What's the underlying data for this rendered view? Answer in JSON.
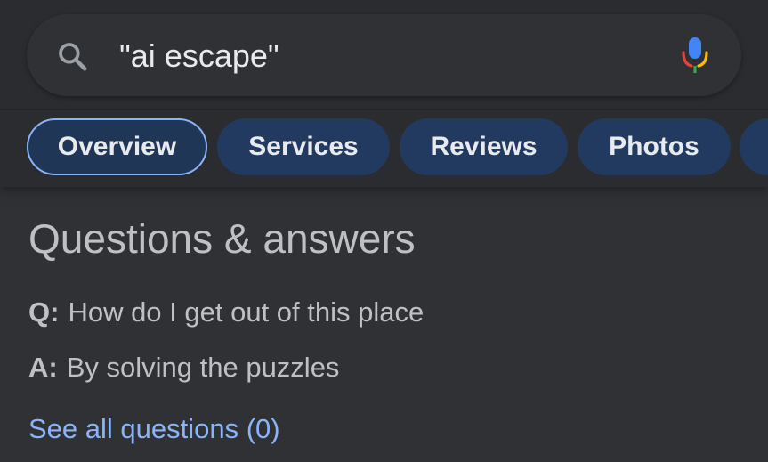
{
  "search": {
    "query": "\"ai escape\"",
    "search_icon": "search-icon",
    "mic_icon": "microphone-icon"
  },
  "tabs": [
    {
      "label": "Overview",
      "active": true
    },
    {
      "label": "Services",
      "active": false
    },
    {
      "label": "Reviews",
      "active": false
    },
    {
      "label": "Photos",
      "active": false
    }
  ],
  "qa": {
    "heading": "Questions & answers",
    "question_prefix": "Q:",
    "question_text": "How do I get out of this place",
    "answer_prefix": "A:",
    "answer_text": "By solving the puzzles",
    "see_all_label": "See all questions (0)"
  },
  "colors": {
    "background": "#303134",
    "chip_background": "#223a5f",
    "chip_active_border": "#8ab4f8",
    "link": "#8ab4f8",
    "text": "#bdc1c6"
  }
}
